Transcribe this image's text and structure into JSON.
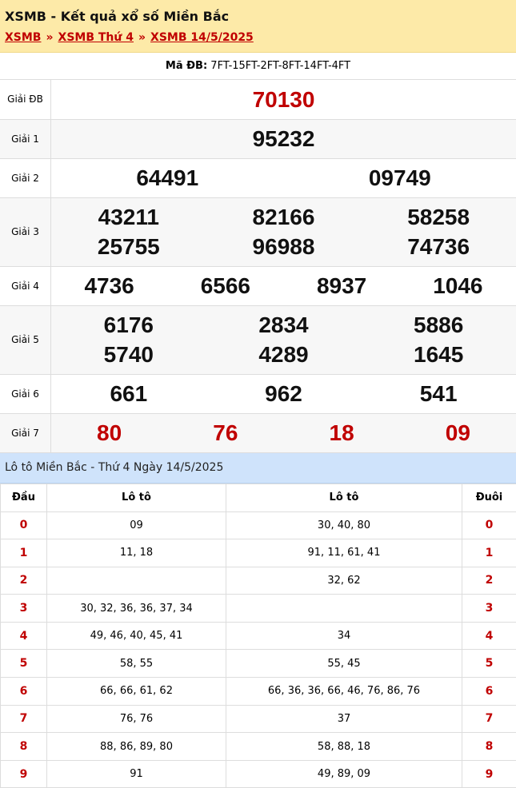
{
  "header": {
    "title": "XSMB - Kết quả xổ số Miền Bắc",
    "breadcrumbs": [
      "XSMB",
      "XSMB Thứ 4",
      "XSMB 14/5/2025"
    ],
    "separator": "»"
  },
  "ma_db": {
    "label": "Mã ĐB:",
    "value": "7FT-15FT-2FT-8FT-14FT-4FT"
  },
  "prizes": [
    {
      "label": "Giải ĐB",
      "cols": 1,
      "numbers": [
        "70130"
      ],
      "red": true,
      "alt": false
    },
    {
      "label": "Giải 1",
      "cols": 1,
      "numbers": [
        "95232"
      ],
      "red": false,
      "alt": true
    },
    {
      "label": "Giải 2",
      "cols": 2,
      "numbers": [
        "64491",
        "09749"
      ],
      "red": false,
      "alt": false
    },
    {
      "label": "Giải 3",
      "cols": 3,
      "numbers": [
        "43211",
        "82166",
        "58258",
        "25755",
        "96988",
        "74736"
      ],
      "red": false,
      "alt": true
    },
    {
      "label": "Giải 4",
      "cols": 4,
      "numbers": [
        "4736",
        "6566",
        "8937",
        "1046"
      ],
      "red": false,
      "alt": false
    },
    {
      "label": "Giải 5",
      "cols": 3,
      "numbers": [
        "6176",
        "2834",
        "5886",
        "5740",
        "4289",
        "1645"
      ],
      "red": false,
      "alt": true
    },
    {
      "label": "Giải 6",
      "cols": 3,
      "numbers": [
        "661",
        "962",
        "541"
      ],
      "red": false,
      "alt": false
    },
    {
      "label": "Giải 7",
      "cols": 4,
      "numbers": [
        "80",
        "76",
        "18",
        "09"
      ],
      "red": true,
      "alt": true
    }
  ],
  "loto": {
    "title": "Lô tô Miền Bắc - Thứ 4 Ngày 14/5/2025",
    "headers": [
      "Đầu",
      "Lô tô",
      "Lô tô",
      "Đuôi"
    ],
    "rows": [
      {
        "head": "0",
        "left": "09",
        "right": "30, 40, 80",
        "tail": "0"
      },
      {
        "head": "1",
        "left": "11, 18",
        "right": "91, 11, 61, 41",
        "tail": "1"
      },
      {
        "head": "2",
        "left": "",
        "right": "32, 62",
        "tail": "2"
      },
      {
        "head": "3",
        "left": "30, 32, 36, 36, 37, 34",
        "right": "",
        "tail": "3"
      },
      {
        "head": "4",
        "left": "49, 46, 40, 45, 41",
        "right": "34",
        "tail": "4"
      },
      {
        "head": "5",
        "left": "58, 55",
        "right": "55, 45",
        "tail": "5"
      },
      {
        "head": "6",
        "left": "66, 66, 61, 62",
        "right": "66, 36, 36, 66, 46, 76, 86, 76",
        "tail": "6"
      },
      {
        "head": "7",
        "left": "76, 76",
        "right": "37",
        "tail": "7"
      },
      {
        "head": "8",
        "left": "88, 86, 89, 80",
        "right": "58, 88, 18",
        "tail": "8"
      },
      {
        "head": "9",
        "left": "91",
        "right": "49, 89, 09",
        "tail": "9"
      }
    ]
  },
  "colors": {
    "accent": "#c00000",
    "header_bg": "#fdeaa8",
    "loto_header_bg": "#cfe3fb"
  }
}
